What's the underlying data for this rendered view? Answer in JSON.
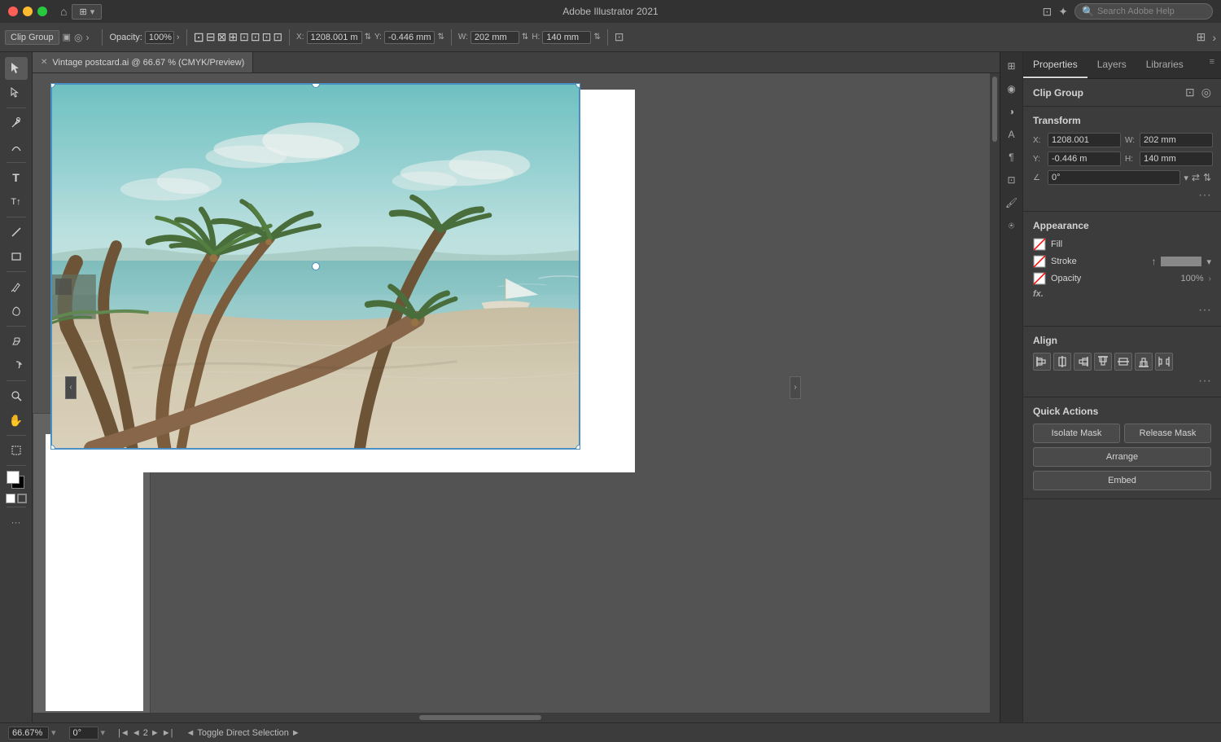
{
  "app": {
    "title": "Adobe Illustrator 2021",
    "search_placeholder": "Search Adobe Help"
  },
  "window_controls": {
    "close": "●",
    "minimize": "●",
    "maximize": "●"
  },
  "toolbar": {
    "breadcrumb": "Clip Group",
    "opacity_label": "Opacity:",
    "opacity_value": "100%",
    "x_label": "X:",
    "x_value": "1208.001 m",
    "y_label": "Y:",
    "y_value": "-0.446 mm",
    "w_label": "W:",
    "w_value": "202 mm",
    "h_label": "H:",
    "h_value": "140 mm"
  },
  "tab": {
    "name": "Vintage postcard.ai @ 66.67 % (CMYK/Preview)"
  },
  "right_panel": {
    "tabs": [
      "Properties",
      "Layers",
      "Libraries"
    ],
    "active_tab": "Properties",
    "section_name": "Clip Group",
    "transform": {
      "title": "Transform",
      "x_label": "X:",
      "x_value": "1208.001",
      "y_label": "Y:",
      "y_value": "-0.446 m",
      "w_label": "W:",
      "w_value": "202 mm",
      "h_label": "H:",
      "h_value": "140 mm",
      "angle_label": "∠",
      "angle_value": "0°"
    },
    "appearance": {
      "title": "Appearance",
      "fill_label": "Fill",
      "stroke_label": "Stroke",
      "opacity_label": "Opacity",
      "opacity_value": "100%"
    },
    "align": {
      "title": "Align"
    },
    "quick_actions": {
      "title": "Quick Actions",
      "isolate_mask": "Isolate Mask",
      "release_mask": "Release Mask",
      "arrange": "Arrange",
      "embed": "Embed"
    }
  },
  "status_bar": {
    "zoom": "66.67%",
    "angle": "0°",
    "nav_text": "Toggle Direct Selection",
    "page_num": "2"
  },
  "icons": {
    "close": "✕",
    "arrow_right": "›",
    "arrow_left": "‹",
    "more": "···",
    "collapse": "‹",
    "expand": "›",
    "chevron_down": "▾"
  }
}
